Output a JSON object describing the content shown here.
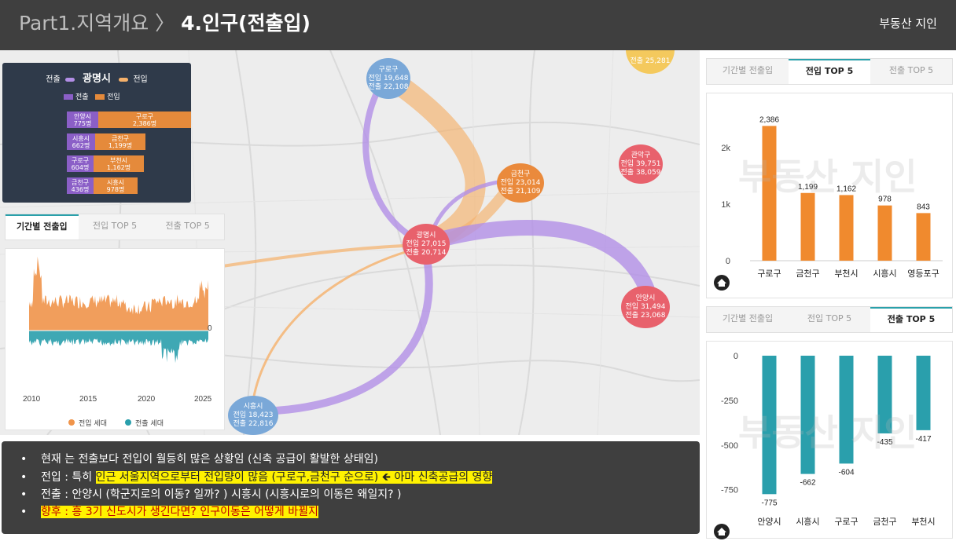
{
  "header": {
    "section": "Part1.지역개요",
    "arrow": "〉",
    "current": "4.인구(전출입)",
    "brand": "부동산 지인"
  },
  "map": {
    "legend": {
      "out_label": "전출",
      "city": "광명시",
      "in_label": "전입",
      "key_out": "전출",
      "key_in": "전입",
      "rows": [
        {
          "out_name": "안양시",
          "out_val": "775명",
          "in_name": "구로구",
          "in_val": "2,386명"
        },
        {
          "out_name": "시흥시",
          "out_val": "662명",
          "in_name": "금천구",
          "in_val": "1,199명"
        },
        {
          "out_name": "구로구",
          "out_val": "604명",
          "in_name": "부천시",
          "in_val": "1,162명"
        },
        {
          "out_name": "금천구",
          "out_val": "436명",
          "in_name": "시흥시",
          "in_val": "978명"
        }
      ]
    },
    "bubbles": [
      {
        "name": "구로구",
        "in": "전입 19,648",
        "out": "전출 22,108"
      },
      {
        "name": "금천구",
        "in": "전입 23,014",
        "out": "전출 21,109"
      },
      {
        "name": "관악구",
        "in": "전입 39,751",
        "out": "전출 38,059"
      },
      {
        "name": "광명시",
        "in": "전입 27,015",
        "out": "전출 20,714"
      },
      {
        "name": "안양시",
        "in": "전입 31,494",
        "out": "전출 23,068"
      },
      {
        "name": "시흥시",
        "in": "전입 18,423",
        "out": "전출 22,816"
      },
      {
        "name": "",
        "in": "",
        "out": "전출 25,281"
      }
    ],
    "colors": {
      "out_flow": "#b28ee6",
      "in_flow": "#f5b06a"
    }
  },
  "left_tabs": [
    "기간별 전출입",
    "전입 TOP 5",
    "전출 TOP 5"
  ],
  "left_chart": {
    "zero_label": "0",
    "years": [
      "2010",
      "2015",
      "2020",
      "2025"
    ],
    "legend_in": "전입 세대",
    "legend_out": "전출 세대",
    "colors": {
      "in": "#f0944a",
      "out": "#2a9fac"
    }
  },
  "right_top_tabs": [
    "기간별 전출입",
    "전입 TOP 5",
    "전출 TOP 5"
  ],
  "right_bottom_tabs": [
    "기간별 전출입",
    "전입 TOP 5",
    "전출 TOP 5"
  ],
  "watermark": "부동산 지인",
  "chart_data": [
    {
      "type": "bar",
      "title": "",
      "categories": [
        "구로구",
        "금천구",
        "부천시",
        "시흥시",
        "영등포구"
      ],
      "values": [
        2386,
        1199,
        1162,
        978,
        843
      ],
      "value_labels": [
        "2,386",
        "1,199",
        "1,162",
        "978",
        "843"
      ],
      "y_ticks": [
        "0",
        "1k",
        "2k"
      ],
      "ylim": [
        0,
        2600
      ],
      "color": "#f08a2e",
      "grid": false
    },
    {
      "type": "bar",
      "title": "",
      "categories": [
        "안양시",
        "시흥시",
        "구로구",
        "금천구",
        "부천시"
      ],
      "values": [
        -775,
        -662,
        -604,
        -435,
        -417
      ],
      "value_labels": [
        "-775",
        "-662",
        "-604",
        "-435",
        "-417"
      ],
      "y_ticks": [
        "0",
        "-250",
        "-500",
        "-750"
      ],
      "ylim": [
        -800,
        0
      ],
      "color": "#2a9fac",
      "grid": false
    }
  ],
  "notes": {
    "l1": "현재 는  전출보다 전입이 월등히 많은 상황임 (신축 공급이 활발한 상태임)",
    "l2_pre": "전입 : 특히 ",
    "l2_hl": "인근 서울지역으로부터 전입량이 많음 (구로구,금천구 순으로) ",
    "l2_arrow": "🡸",
    "l2_hl2": " 아마 신축공급의 영향",
    "l3": "전출 : 안양시 (학군지로의 이동? 일까? )  시흥시 (시흥시로의 이동은 왜일지? )",
    "l4": "향후 : 흥 3기 신도시가 생긴다면?  인구이동은 어떻게 바뀔지",
    "bullet": "•"
  }
}
